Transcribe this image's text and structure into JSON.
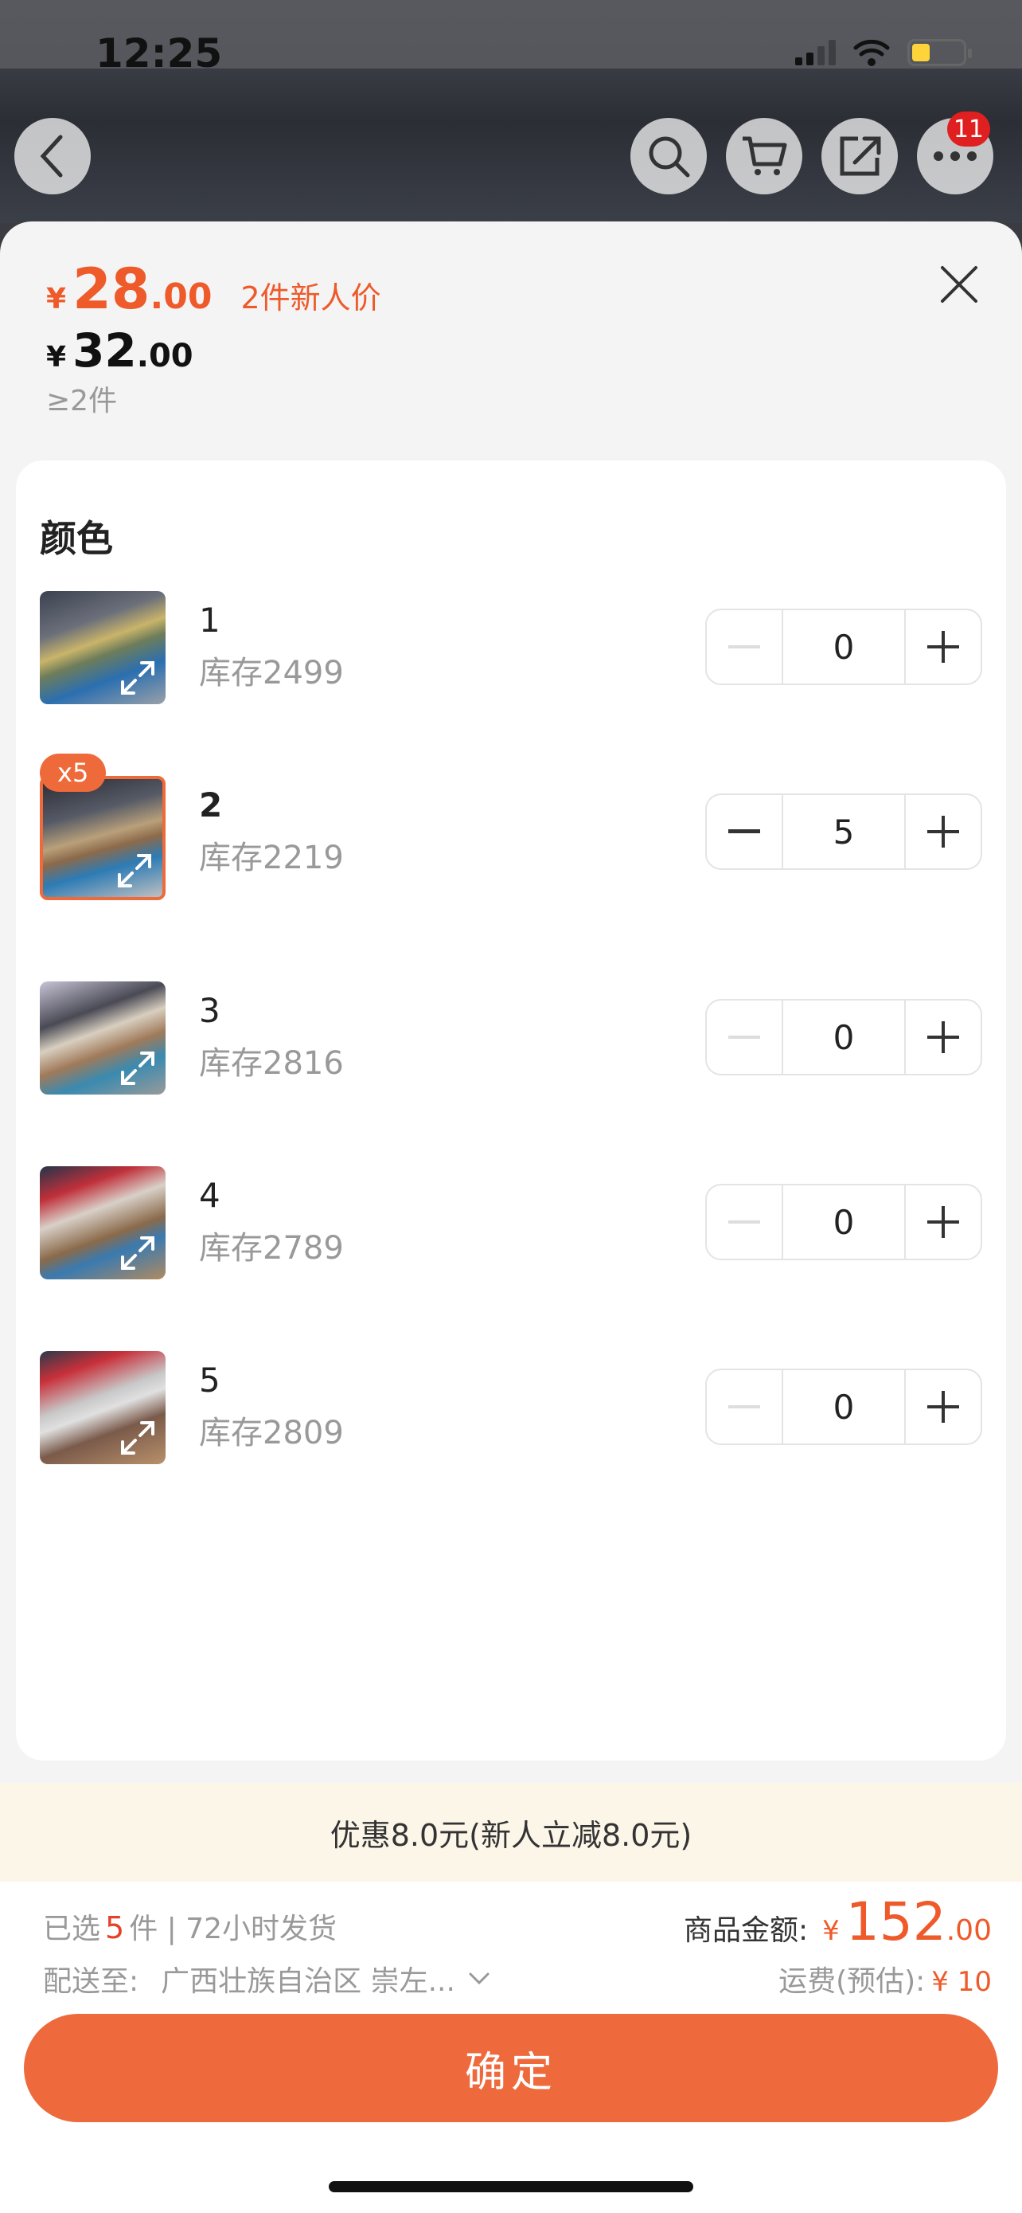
{
  "status": {
    "time": "12:25"
  },
  "topbar": {
    "cart_badge": "11"
  },
  "price": {
    "promo_currency": "¥",
    "promo_int": "28",
    "promo_dec": ".00",
    "promo_label": "2件新人价",
    "base_currency": "¥",
    "base_int": "32",
    "base_dec": ".00",
    "min_qty": "≥2件"
  },
  "section": {
    "title": "颜色"
  },
  "options": [
    {
      "name": "1",
      "stock": "库存2499",
      "qty": "0"
    },
    {
      "name": "2",
      "stock": "库存2219",
      "qty": "5",
      "badge": "x5"
    },
    {
      "name": "3",
      "stock": "库存2816",
      "qty": "0"
    },
    {
      "name": "4",
      "stock": "库存2789",
      "qty": "0"
    },
    {
      "name": "5",
      "stock": "库存2809",
      "qty": "0"
    }
  ],
  "discount": {
    "text": "优惠8.0元(新人立减8.0元)"
  },
  "footer": {
    "selected_prefix": "已选",
    "selected_count": "5",
    "selected_suffix": "件 | 72小时发货",
    "ship_label": "配送至:",
    "ship_address": "广西壮族自治区 崇左...",
    "amount_label": "商品金额:",
    "amount_currency": "¥",
    "amount_int": "152",
    "amount_dec": ".00",
    "freight_label": "运费(预估):",
    "freight_value": "¥ 10",
    "confirm_label": "确定"
  },
  "colors": {
    "accent": "#ee6a3d",
    "price": "#ee5a2a"
  }
}
